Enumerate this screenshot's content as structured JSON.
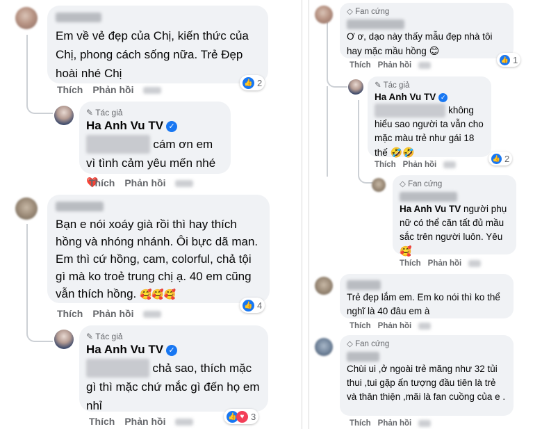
{
  "left": {
    "c1": {
      "text": "Em về vẻ đẹp của Chị, kiến thức của Chị, phong cách sống nữa. Trẻ Đẹp hoài nhé Chị",
      "actions": [
        "Thích",
        "Phản hồi"
      ],
      "reaction_count": "2"
    },
    "r1": {
      "badge": "Tác giả",
      "author": "Ha Anh Vu TV",
      "text": "cám ơn em vì tình cảm yêu mến nhé",
      "emoji": "❤️",
      "actions": [
        "Thích",
        "Phản hồi"
      ]
    },
    "c2": {
      "text": "Bạn e nói xoáy già rồi thì hay thích hồng và nhóng nhánh. Ôi bực dã man. Em thì cứ hồng, cam, colorful, chả tội gì mà ko troẻ trung chị ạ. 40 em cũng vẫn thích hồng.",
      "emoji": "🥰🥰🥰",
      "actions": [
        "Thích",
        "Phản hồi"
      ],
      "reaction_count": "4"
    },
    "r2": {
      "badge": "Tác giả",
      "author": "Ha Anh Vu TV",
      "text": "chả sao, thích mặc gì thì mặc chứ mắc gì đến họ em nhỉ",
      "actions": [
        "Thích",
        "Phản hồi"
      ],
      "reaction_count": "3"
    }
  },
  "right": {
    "c1": {
      "badge": "Fan cứng",
      "text": "Ơ ơ, dạo này thấy mẫu đẹp nhà tôi hay mặc mầu hồng",
      "emoji": "😊",
      "actions": [
        "Thích",
        "Phản hồi"
      ],
      "reaction_count": "1"
    },
    "r1": {
      "badge": "Tác giả",
      "author": "Ha Anh Vu TV",
      "text": "không hiểu sao người ta vẫn cho mặc màu trẻ như gái 18 thế",
      "emoji": "🤣🤣",
      "actions": [
        "Thích",
        "Phản hồi"
      ],
      "reaction_count": "2"
    },
    "r2": {
      "badge": "Fan cứng",
      "author": "Ha Anh Vu TV",
      "text": "người phụ nữ có thể căn tất đủ mầu sắc trên người luôn. Yêu",
      "emoji": "🥰",
      "actions": [
        "Thích",
        "Phản hồi"
      ]
    },
    "c2": {
      "text": "Trẻ đẹp lắm em. Em ko nói thì ko thể nghĩ là 40 đâu em à",
      "actions": [
        "Thích",
        "Phản hồi"
      ]
    },
    "c3": {
      "badge": "Fan cứng",
      "text": "Chùi ui ,ở ngoài trẻ măng như 32 tủi thui ,tui gặp ấn tượng đầu tiên là trẻ và thân thiện ,mãi là fan cuồng của e .",
      "actions": [
        "Thích",
        "Phản hồi"
      ]
    }
  },
  "colors": {
    "like": "#1877f2",
    "heart": "#f33e58",
    "haha": "#f7b125",
    "bubble": "#f0f2f5",
    "meta": "#65676b"
  }
}
